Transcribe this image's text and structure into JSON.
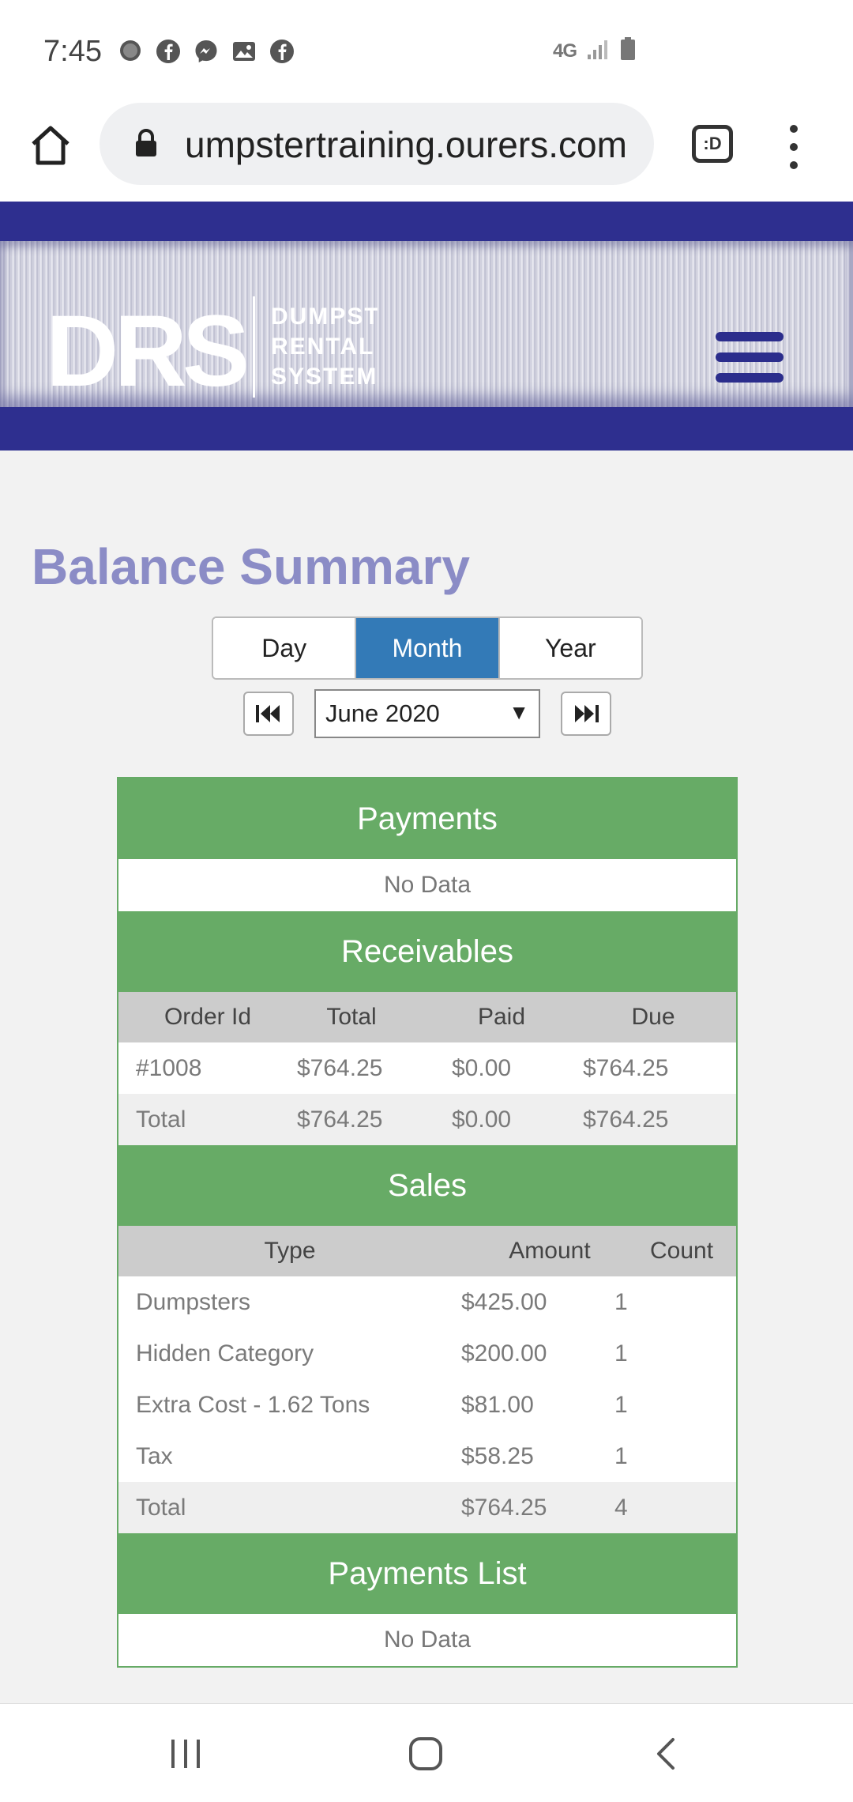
{
  "status_bar": {
    "time": "7:45",
    "network": "4G",
    "icons_left": [
      "chat-bubble-icon",
      "facebook-icon",
      "messenger-icon",
      "gallery-icon",
      "facebook-icon"
    ],
    "icons_right": [
      "network-4g-icon",
      "signal-icon",
      "battery-icon"
    ]
  },
  "browser": {
    "url": "umpstertraining.ourers.com",
    "tabs_label": ":D"
  },
  "header": {
    "logo_letters": "DRS",
    "logo_tagline": [
      "DUMPSTER",
      "RENTAL",
      "SYSTEMS"
    ],
    "brand_color": "#2e2f8f"
  },
  "page": {
    "title": "Balance Summary",
    "period_tabs": [
      {
        "label": "Day",
        "active": false
      },
      {
        "label": "Month",
        "active": true
      },
      {
        "label": "Year",
        "active": false
      }
    ],
    "selected_period": "June 2020",
    "accent_color": "#337ab7",
    "section_color": "#67ab66"
  },
  "payments": {
    "title": "Payments",
    "empty_text": "No Data"
  },
  "receivables": {
    "title": "Receivables",
    "columns": [
      "Order Id",
      "Total",
      "Paid",
      "Due"
    ],
    "rows": [
      [
        "#1008",
        "$764.25",
        "$0.00",
        "$764.25"
      ]
    ],
    "total": [
      "Total",
      "$764.25",
      "$0.00",
      "$764.25"
    ]
  },
  "sales": {
    "title": "Sales",
    "columns": [
      "Type",
      "Amount",
      "Count"
    ],
    "rows": [
      [
        "Dumpsters",
        "$425.00",
        "1"
      ],
      [
        "Hidden Category",
        "$200.00",
        "1"
      ],
      [
        "Extra Cost - 1.62 Tons",
        "$81.00",
        "1"
      ],
      [
        "Tax",
        "$58.25",
        "1"
      ]
    ],
    "total": [
      "Total",
      "$764.25",
      "4"
    ]
  },
  "payments_list": {
    "title": "Payments List",
    "empty_text": "No Data"
  }
}
